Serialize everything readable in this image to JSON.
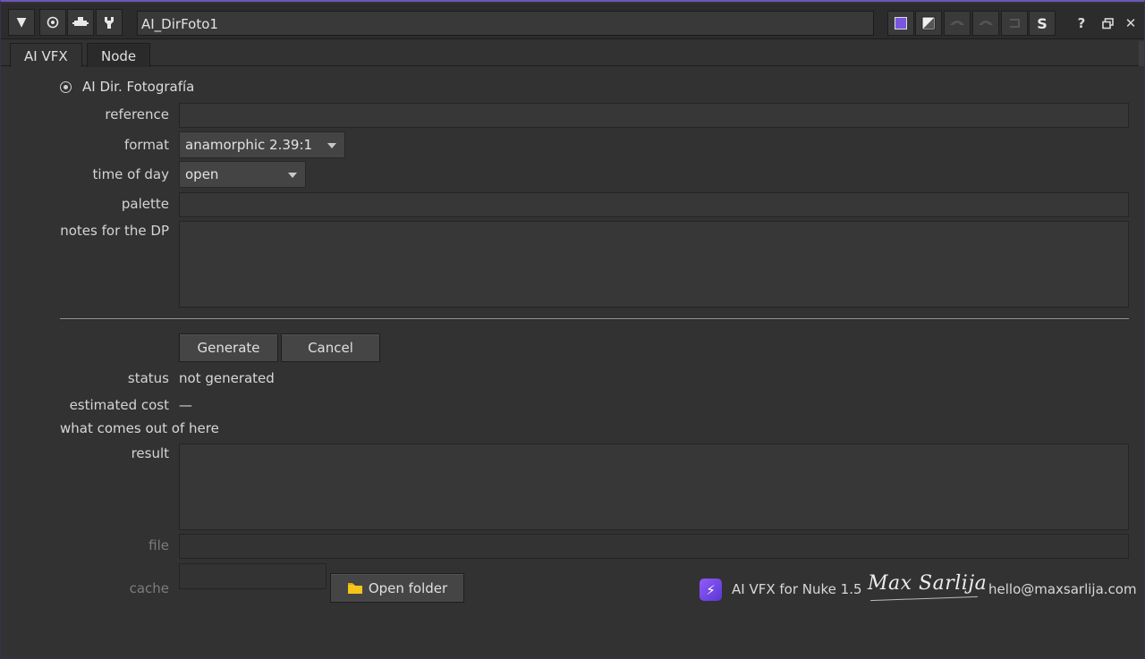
{
  "header": {
    "node_name": "AI_DirFoto1",
    "icons": [
      "triangle-down-icon",
      "target-icon",
      "pin-icon",
      "wrench-icon",
      "purple-swatch-icon",
      "slash-swatch-icon",
      "undo-icon",
      "redo-icon",
      "revert-icon",
      "s-icon",
      "help-icon",
      "restore-icon",
      "close-icon"
    ],
    "s_label": "S",
    "help_label": "?",
    "close_label": "✕"
  },
  "tabs": [
    {
      "label": "AI VFX",
      "active": true
    },
    {
      "label": "Node",
      "active": false
    }
  ],
  "form": {
    "section_title": "AI Dir. Fotografía",
    "reference_label": "reference",
    "reference_value": "",
    "format_label": "format",
    "format_value": "anamorphic 2.39:1",
    "time_label": "time of day",
    "time_value": "open",
    "palette_label": "palette",
    "palette_value": "",
    "notes_label": "notes for the DP",
    "notes_value": "",
    "generate_label": "Generate",
    "cancel_label": "Cancel",
    "status_label": "status",
    "status_value": "not generated",
    "cost_label": "estimated cost",
    "cost_value": "—",
    "out_heading": "what comes out of here",
    "result_label": "result",
    "file_label": "file",
    "cache_label": "cache",
    "open_folder_label": "Open folder"
  },
  "footer": {
    "product": "AI VFX for Nuke 1.5",
    "signature": "Max Sarlija",
    "email": "hello@maxsarlija.com"
  },
  "colors": {
    "accent": "#7a55e0",
    "background": "#323232"
  }
}
